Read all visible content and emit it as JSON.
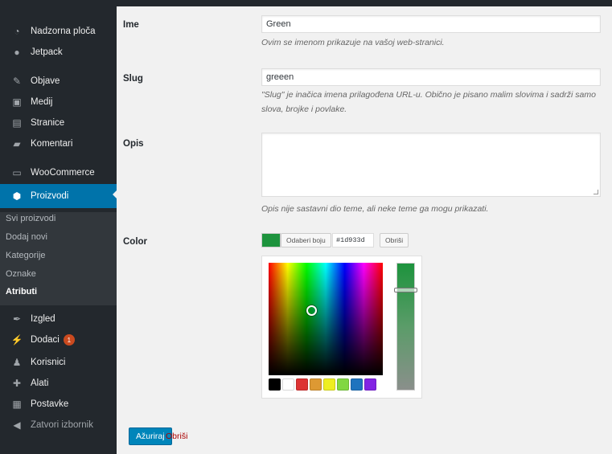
{
  "sidebar": {
    "items": [
      {
        "label": "Nadzorna ploča",
        "icon": "dashboard-icon"
      },
      {
        "label": "Jetpack",
        "icon": "jetpack-icon"
      },
      {
        "label": "Objave",
        "icon": "pin-icon"
      },
      {
        "label": "Medij",
        "icon": "media-icon"
      },
      {
        "label": "Stranice",
        "icon": "pages-icon"
      },
      {
        "label": "Komentari",
        "icon": "comments-icon"
      },
      {
        "label": "WooCommerce",
        "icon": "woocommerce-icon"
      },
      {
        "label": "Proizvodi",
        "icon": "products-icon"
      },
      {
        "label": "Izgled",
        "icon": "appearance-icon"
      },
      {
        "label": "Dodaci",
        "icon": "plugins-icon",
        "badge": "1"
      },
      {
        "label": "Korisnici",
        "icon": "users-icon"
      },
      {
        "label": "Alati",
        "icon": "tools-icon"
      },
      {
        "label": "Postavke",
        "icon": "settings-icon"
      },
      {
        "label": "Zatvori izbornik",
        "icon": "collapse-icon"
      }
    ],
    "submenu": [
      "Svi proizvodi",
      "Dodaj novi",
      "Kategorije",
      "Oznake",
      "Atributi"
    ]
  },
  "form": {
    "name_label": "Ime",
    "name_value": "Green",
    "name_desc": "Ovim se imenom prikazuje na vašoj web-stranici.",
    "slug_label": "Slug",
    "slug_value": "greeen",
    "slug_desc": "\"Slug\" je inačica imena prilagođena URL-u. Obično je pisano malim slovima i sadrži samo slova, brojke i povlake.",
    "desc_label": "Opis",
    "desc_value": "",
    "desc_help": "Opis nije sastavni dio teme, ali neke teme ga mogu prikazati.",
    "color_label": "Color",
    "choose_color": "Odaberi boju",
    "hex_value": "#1d933d",
    "clear_button": "Obriši",
    "update_button": "Ažuriraj",
    "delete_link": "Obriši"
  },
  "colors": {
    "selected": "#1d933d",
    "palette": [
      "#000000",
      "#ffffff",
      "#dd3333",
      "#dd9933",
      "#eeee22",
      "#81d742",
      "#1e73be",
      "#8224e3"
    ],
    "accent": "#0073aa"
  }
}
